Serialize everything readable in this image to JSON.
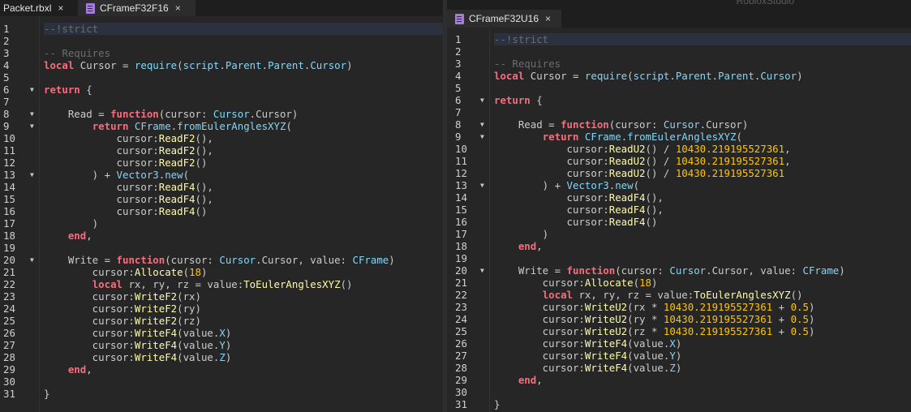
{
  "left_pane": {
    "tabs": [
      {
        "label": "Packet.rbxl",
        "close": "×",
        "active": false,
        "icon": "none"
      },
      {
        "label": "CFrameF32F16",
        "close": "×",
        "active": true,
        "icon": "script-icon"
      }
    ],
    "lines": [
      [
        {
          "t": "--!strict",
          "c": "cm"
        }
      ],
      [],
      [
        {
          "t": "-- Requires",
          "c": "cm"
        }
      ],
      [
        {
          "t": "local",
          "c": "kw"
        },
        {
          "t": " Cursor = "
        },
        {
          "t": "require",
          "c": "bi"
        },
        {
          "t": "("
        },
        {
          "t": "script",
          "c": "bi"
        },
        {
          "t": "."
        },
        {
          "t": "Parent",
          "c": "bi"
        },
        {
          "t": "."
        },
        {
          "t": "Parent",
          "c": "bi"
        },
        {
          "t": "."
        },
        {
          "t": "Cursor",
          "c": "bi"
        },
        {
          "t": ")"
        }
      ],
      [],
      [
        {
          "t": "return",
          "c": "kw"
        },
        {
          "t": " {"
        }
      ],
      [],
      [
        {
          "t": "    Read = "
        },
        {
          "t": "function",
          "c": "kw"
        },
        {
          "t": "(cursor: "
        },
        {
          "t": "Cursor",
          "c": "bi"
        },
        {
          "t": ".Cursor)"
        }
      ],
      [
        {
          "t": "        "
        },
        {
          "t": "return",
          "c": "kw"
        },
        {
          "t": " "
        },
        {
          "t": "CFrame",
          "c": "bi"
        },
        {
          "t": "."
        },
        {
          "t": "fromEulerAnglesXYZ",
          "c": "bi"
        },
        {
          "t": "("
        }
      ],
      [
        {
          "t": "            cursor:"
        },
        {
          "t": "ReadF2",
          "c": "fn"
        },
        {
          "t": "(),"
        }
      ],
      [
        {
          "t": "            cursor:"
        },
        {
          "t": "ReadF2",
          "c": "fn"
        },
        {
          "t": "(),"
        }
      ],
      [
        {
          "t": "            cursor:"
        },
        {
          "t": "ReadF2",
          "c": "fn"
        },
        {
          "t": "()"
        }
      ],
      [
        {
          "t": "        ) + "
        },
        {
          "t": "Vector3",
          "c": "bi"
        },
        {
          "t": "."
        },
        {
          "t": "new",
          "c": "bi"
        },
        {
          "t": "("
        }
      ],
      [
        {
          "t": "            cursor:"
        },
        {
          "t": "ReadF4",
          "c": "fn"
        },
        {
          "t": "(),"
        }
      ],
      [
        {
          "t": "            cursor:"
        },
        {
          "t": "ReadF4",
          "c": "fn"
        },
        {
          "t": "(),"
        }
      ],
      [
        {
          "t": "            cursor:"
        },
        {
          "t": "ReadF4",
          "c": "fn"
        },
        {
          "t": "()"
        }
      ],
      [
        {
          "t": "        )"
        }
      ],
      [
        {
          "t": "    "
        },
        {
          "t": "end",
          "c": "kw"
        },
        {
          "t": ","
        }
      ],
      [],
      [
        {
          "t": "    Write = "
        },
        {
          "t": "function",
          "c": "kw"
        },
        {
          "t": "(cursor: "
        },
        {
          "t": "Cursor",
          "c": "bi"
        },
        {
          "t": ".Cursor, value: "
        },
        {
          "t": "CFrame",
          "c": "bi"
        },
        {
          "t": ")"
        }
      ],
      [
        {
          "t": "        cursor:"
        },
        {
          "t": "Allocate",
          "c": "fn"
        },
        {
          "t": "("
        },
        {
          "t": "18",
          "c": "nm"
        },
        {
          "t": ")"
        }
      ],
      [
        {
          "t": "        "
        },
        {
          "t": "local",
          "c": "kw"
        },
        {
          "t": " rx, ry, rz = value:"
        },
        {
          "t": "ToEulerAnglesXYZ",
          "c": "fn"
        },
        {
          "t": "()"
        }
      ],
      [
        {
          "t": "        cursor:"
        },
        {
          "t": "WriteF2",
          "c": "fn"
        },
        {
          "t": "(rx)"
        }
      ],
      [
        {
          "t": "        cursor:"
        },
        {
          "t": "WriteF2",
          "c": "fn"
        },
        {
          "t": "(ry)"
        }
      ],
      [
        {
          "t": "        cursor:"
        },
        {
          "t": "WriteF2",
          "c": "fn"
        },
        {
          "t": "(rz)"
        }
      ],
      [
        {
          "t": "        cursor:"
        },
        {
          "t": "WriteF4",
          "c": "fn"
        },
        {
          "t": "(value."
        },
        {
          "t": "X",
          "c": "bi"
        },
        {
          "t": ")"
        }
      ],
      [
        {
          "t": "        cursor:"
        },
        {
          "t": "WriteF4",
          "c": "fn"
        },
        {
          "t": "(value."
        },
        {
          "t": "Y",
          "c": "bi"
        },
        {
          "t": ")"
        }
      ],
      [
        {
          "t": "        cursor:"
        },
        {
          "t": "WriteF4",
          "c": "fn"
        },
        {
          "t": "(value."
        },
        {
          "t": "Z",
          "c": "bi"
        },
        {
          "t": ")"
        }
      ],
      [
        {
          "t": "    "
        },
        {
          "t": "end",
          "c": "kw"
        },
        {
          "t": ","
        }
      ],
      [],
      [
        {
          "t": "}"
        }
      ]
    ],
    "fold_lines": [
      6,
      8,
      9,
      13,
      20
    ]
  },
  "right_pane": {
    "app_label": "RobloxStudio",
    "tabs": [
      {
        "label": "CFrameF32U16",
        "close": "×",
        "active": true,
        "icon": "script-icon"
      }
    ],
    "lines": [
      [
        {
          "t": "--!strict",
          "c": "cm"
        }
      ],
      [],
      [
        {
          "t": "-- Requires",
          "c": "cm"
        }
      ],
      [
        {
          "t": "local",
          "c": "kw"
        },
        {
          "t": " Cursor = "
        },
        {
          "t": "require",
          "c": "bi"
        },
        {
          "t": "("
        },
        {
          "t": "script",
          "c": "bi"
        },
        {
          "t": "."
        },
        {
          "t": "Parent",
          "c": "bi"
        },
        {
          "t": "."
        },
        {
          "t": "Parent",
          "c": "bi"
        },
        {
          "t": "."
        },
        {
          "t": "Cursor",
          "c": "bi"
        },
        {
          "t": ")"
        }
      ],
      [],
      [
        {
          "t": "return",
          "c": "kw"
        },
        {
          "t": " {"
        }
      ],
      [],
      [
        {
          "t": "    Read = "
        },
        {
          "t": "function",
          "c": "kw"
        },
        {
          "t": "(cursor: "
        },
        {
          "t": "Cursor",
          "c": "bi"
        },
        {
          "t": ".Cursor)"
        }
      ],
      [
        {
          "t": "        "
        },
        {
          "t": "return",
          "c": "kw"
        },
        {
          "t": " "
        },
        {
          "t": "CFrame",
          "c": "bi"
        },
        {
          "t": "."
        },
        {
          "t": "fromEulerAnglesXYZ",
          "c": "bi"
        },
        {
          "t": "("
        }
      ],
      [
        {
          "t": "            cursor:"
        },
        {
          "t": "ReadU2",
          "c": "fn"
        },
        {
          "t": "() / "
        },
        {
          "t": "10430.219195527361",
          "c": "nm"
        },
        {
          "t": ","
        }
      ],
      [
        {
          "t": "            cursor:"
        },
        {
          "t": "ReadU2",
          "c": "fn"
        },
        {
          "t": "() / "
        },
        {
          "t": "10430.219195527361",
          "c": "nm"
        },
        {
          "t": ","
        }
      ],
      [
        {
          "t": "            cursor:"
        },
        {
          "t": "ReadU2",
          "c": "fn"
        },
        {
          "t": "() / "
        },
        {
          "t": "10430.219195527361",
          "c": "nm"
        }
      ],
      [
        {
          "t": "        ) + "
        },
        {
          "t": "Vector3",
          "c": "bi"
        },
        {
          "t": "."
        },
        {
          "t": "new",
          "c": "bi"
        },
        {
          "t": "("
        }
      ],
      [
        {
          "t": "            cursor:"
        },
        {
          "t": "ReadF4",
          "c": "fn"
        },
        {
          "t": "(),"
        }
      ],
      [
        {
          "t": "            cursor:"
        },
        {
          "t": "ReadF4",
          "c": "fn"
        },
        {
          "t": "(),"
        }
      ],
      [
        {
          "t": "            cursor:"
        },
        {
          "t": "ReadF4",
          "c": "fn"
        },
        {
          "t": "()"
        }
      ],
      [
        {
          "t": "        )"
        }
      ],
      [
        {
          "t": "    "
        },
        {
          "t": "end",
          "c": "kw"
        },
        {
          "t": ","
        }
      ],
      [],
      [
        {
          "t": "    Write = "
        },
        {
          "t": "function",
          "c": "kw"
        },
        {
          "t": "(cursor: "
        },
        {
          "t": "Cursor",
          "c": "bi"
        },
        {
          "t": ".Cursor, value: "
        },
        {
          "t": "CFrame",
          "c": "bi"
        },
        {
          "t": ")"
        }
      ],
      [
        {
          "t": "        cursor:"
        },
        {
          "t": "Allocate",
          "c": "fn"
        },
        {
          "t": "("
        },
        {
          "t": "18",
          "c": "nm"
        },
        {
          "t": ")"
        }
      ],
      [
        {
          "t": "        "
        },
        {
          "t": "local",
          "c": "kw"
        },
        {
          "t": " rx, ry, rz = value:"
        },
        {
          "t": "ToEulerAnglesXYZ",
          "c": "fn"
        },
        {
          "t": "()"
        }
      ],
      [
        {
          "t": "        cursor:"
        },
        {
          "t": "WriteU2",
          "c": "fn"
        },
        {
          "t": "(rx * "
        },
        {
          "t": "10430.219195527361",
          "c": "nm"
        },
        {
          "t": " + "
        },
        {
          "t": "0.5",
          "c": "nm"
        },
        {
          "t": ")"
        }
      ],
      [
        {
          "t": "        cursor:"
        },
        {
          "t": "WriteU2",
          "c": "fn"
        },
        {
          "t": "(ry * "
        },
        {
          "t": "10430.219195527361",
          "c": "nm"
        },
        {
          "t": " + "
        },
        {
          "t": "0.5",
          "c": "nm"
        },
        {
          "t": ")"
        }
      ],
      [
        {
          "t": "        cursor:"
        },
        {
          "t": "WriteU2",
          "c": "fn"
        },
        {
          "t": "(rz * "
        },
        {
          "t": "10430.219195527361",
          "c": "nm"
        },
        {
          "t": " + "
        },
        {
          "t": "0.5",
          "c": "nm"
        },
        {
          "t": ")"
        }
      ],
      [
        {
          "t": "        cursor:"
        },
        {
          "t": "WriteF4",
          "c": "fn"
        },
        {
          "t": "(value."
        },
        {
          "t": "X",
          "c": "bi"
        },
        {
          "t": ")"
        }
      ],
      [
        {
          "t": "        cursor:"
        },
        {
          "t": "WriteF4",
          "c": "fn"
        },
        {
          "t": "(value."
        },
        {
          "t": "Y",
          "c": "bi"
        },
        {
          "t": ")"
        }
      ],
      [
        {
          "t": "        cursor:"
        },
        {
          "t": "WriteF4",
          "c": "fn"
        },
        {
          "t": "(value."
        },
        {
          "t": "Z",
          "c": "bi"
        },
        {
          "t": ")"
        }
      ],
      [
        {
          "t": "    "
        },
        {
          "t": "end",
          "c": "kw"
        },
        {
          "t": ","
        }
      ],
      [],
      [
        {
          "t": "}"
        }
      ]
    ],
    "fold_lines": [
      6,
      8,
      9,
      13,
      20
    ]
  },
  "colors": {
    "keyword": "#f86d7c",
    "comment": "#6d6d6d",
    "method": "#fdfbac",
    "builtin": "#84d6f7",
    "number": "#ffc600",
    "background": "#262626"
  }
}
